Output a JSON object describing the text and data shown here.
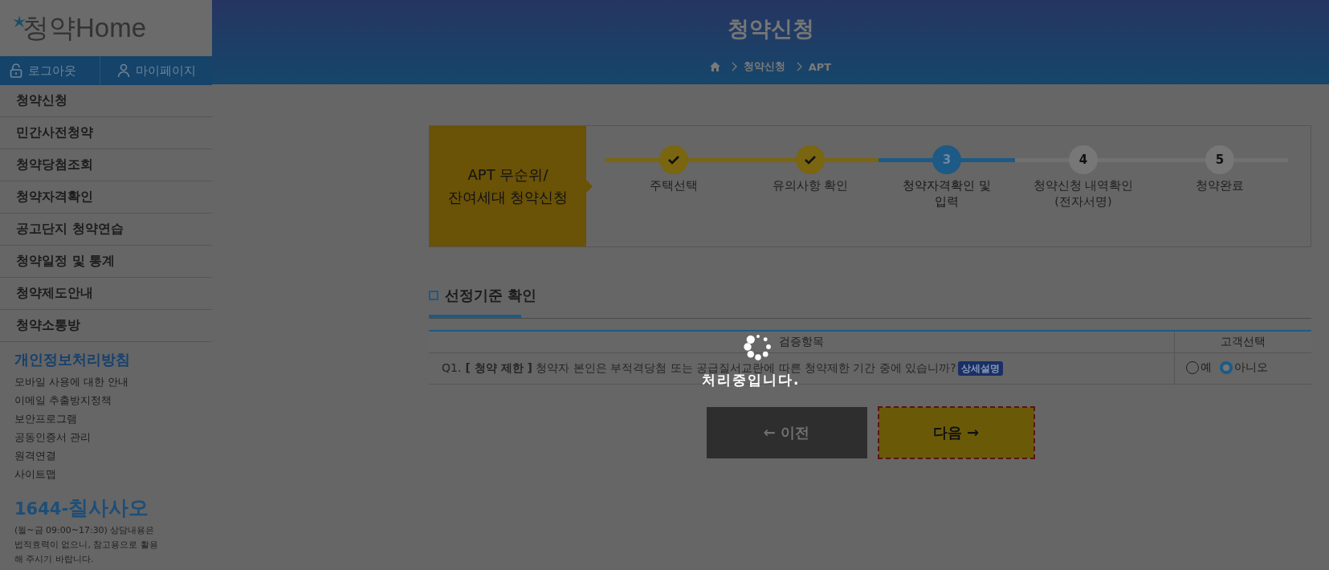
{
  "logo": {
    "text": "청약Home"
  },
  "account_links": [
    {
      "kind": "logout",
      "label": "로그아웃"
    },
    {
      "kind": "mypage",
      "label": "마이페이지"
    }
  ],
  "menu": [
    "청약신청",
    "민간사전청약",
    "청약당첨조회",
    "청약자격확인",
    "공고단지 청약연습",
    "청약일정 및 통계",
    "청약제도안내",
    "청약소통방"
  ],
  "privacy": {
    "title": "개인정보처리방침",
    "links": [
      "모바일 사용에 대한 안내",
      "이메일 추출방지정책",
      "보안프로그램",
      "공동인증서 관리",
      "원격연결",
      "사이트맵"
    ]
  },
  "phone": {
    "number": "1644-",
    "word": "칠사사오",
    "note": "(월~금 09:00~17:30) 상담내용은 법적효력이 없으니, 참고용으로 활용해 주시기 바랍니다."
  },
  "header": {
    "title": "청약신청",
    "breadcrumb": [
      "청약신청",
      "APT"
    ]
  },
  "steps_box": {
    "title_lines": [
      "APT 무순위/",
      "잔여세대 청약신청"
    ],
    "steps": [
      {
        "completed": true,
        "label_lines": [
          "주택선택"
        ]
      },
      {
        "completed": true,
        "label_lines": [
          "유의사항 확인"
        ]
      },
      {
        "completed": false,
        "current": true,
        "number": "3",
        "label_lines": [
          "청약자격확인 및",
          "입력"
        ]
      },
      {
        "completed": false,
        "current": false,
        "number": "4",
        "label_lines": [
          "청약신청 내역확인",
          "(전자서명)"
        ]
      },
      {
        "completed": false,
        "current": false,
        "number": "5",
        "label_lines": [
          "청약완료"
        ]
      }
    ]
  },
  "section": {
    "title": "선정기준 확인"
  },
  "table": {
    "columns": [
      "검증항목",
      "고객선택"
    ],
    "rows": [
      {
        "number": "Q1.",
        "text": "**[ 청약 제한 ]** 청약자 본인은 부적격당첨 또는 공급질서교란에 따른 청약제한 기간 중에 있습니까?",
        "badge": "상세설명",
        "options": [
          {
            "label": "예",
            "selected": false
          },
          {
            "label": "아니오",
            "selected": true
          }
        ]
      }
    ]
  },
  "buttons": [
    {
      "kind": "prev",
      "label": "← 이전",
      "focused": false
    },
    {
      "kind": "next",
      "label": "다음 →",
      "focused": true
    }
  ],
  "loading": {
    "text": "처리중입니다."
  }
}
